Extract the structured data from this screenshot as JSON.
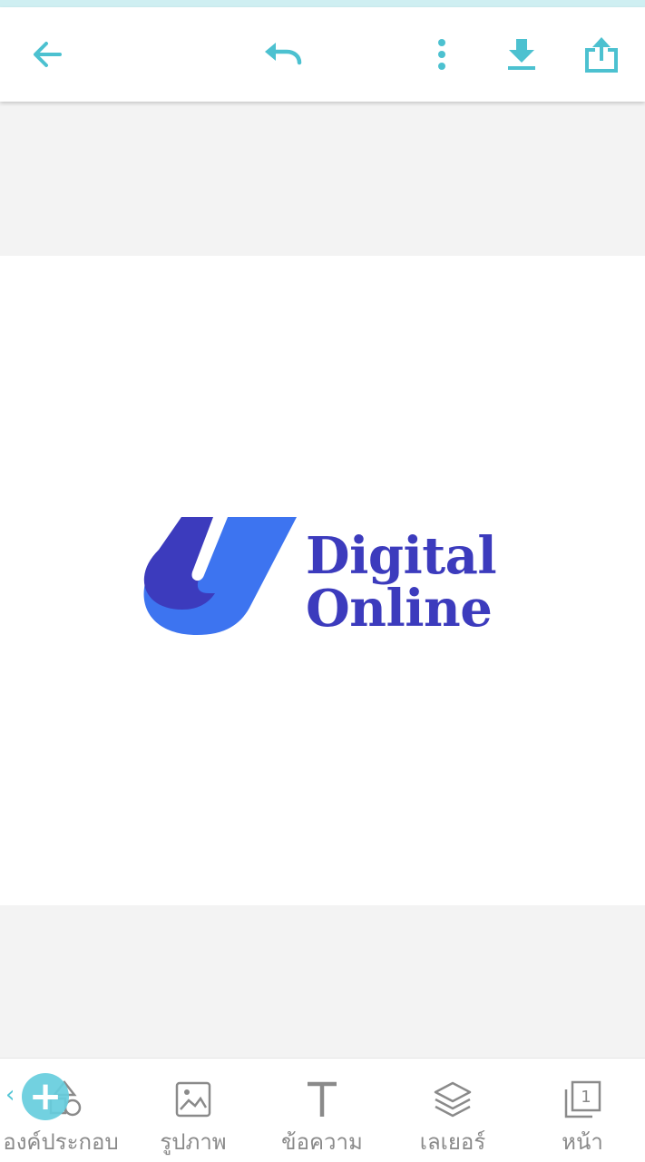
{
  "colors": {
    "accent": "#4cc1d0",
    "brand_dark": "#3c3bbd",
    "brand_light": "#3d74f0",
    "tab_gray": "#8a8a8a"
  },
  "toolbar": {
    "back_icon": "arrow-left-icon",
    "undo_icon": "undo-icon",
    "more_icon": "more-vertical-icon",
    "download_icon": "download-icon",
    "share_icon": "share-icon"
  },
  "canvas": {
    "logo": {
      "line1": "Digital",
      "line2": "Online"
    }
  },
  "bottom_nav": {
    "items": [
      {
        "label": "องค์ประกอบ",
        "icon": "elements-shapes-icon"
      },
      {
        "label": "รูปภาพ",
        "icon": "image-icon"
      },
      {
        "label": "ข้อความ",
        "icon": "text-icon"
      },
      {
        "label": "เลเยอร์",
        "icon": "layers-icon"
      },
      {
        "label": "หน้า",
        "icon": "pages-icon"
      }
    ],
    "page_count_badge": "1"
  },
  "fab": {
    "symbol": "+",
    "icon": "add-icon"
  }
}
